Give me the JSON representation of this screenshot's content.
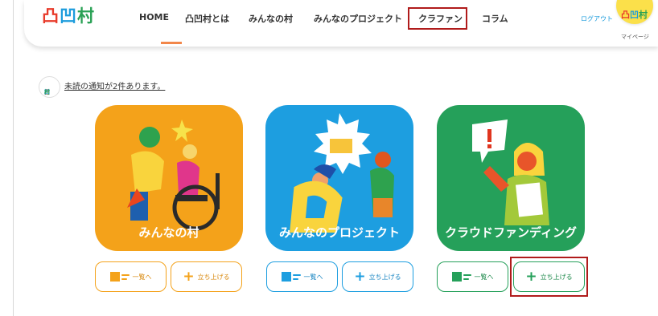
{
  "header": {
    "logo": [
      "凸",
      "凹",
      "村"
    ],
    "nav": [
      "HOME",
      "凸凹村とは",
      "みんなの村",
      "みんなのプロジェクト",
      "クラファン",
      "コラム"
    ],
    "login": "ログアウト",
    "mypage_logo": "凸凹村",
    "mypage": "マイページ"
  },
  "notice": {
    "avatar_text": "凸凹村",
    "text": "未読の通知が2件あります。"
  },
  "cards": [
    {
      "title": "みんなの村",
      "color": "#f4a21a",
      "list_label": "一覧へ",
      "create_label": "立ち上げる",
      "accent": "#f4a21a"
    },
    {
      "title": "みんなのプロジェクト",
      "color": "#1d9ee0",
      "list_label": "一覧へ",
      "create_label": "立ち上げる",
      "accent": "#1d9ee0"
    },
    {
      "title": "クラウドファンディング",
      "color": "#25a05a",
      "list_label": "一覧へ",
      "create_label": "立ち上げる",
      "accent": "#25a05a"
    }
  ],
  "colors": {
    "highlight": "#b01b1b",
    "nav_active": "#f2874a",
    "logo_red": "#e83a2a",
    "logo_blue": "#1d9cdc",
    "logo_green": "#2aa155"
  }
}
